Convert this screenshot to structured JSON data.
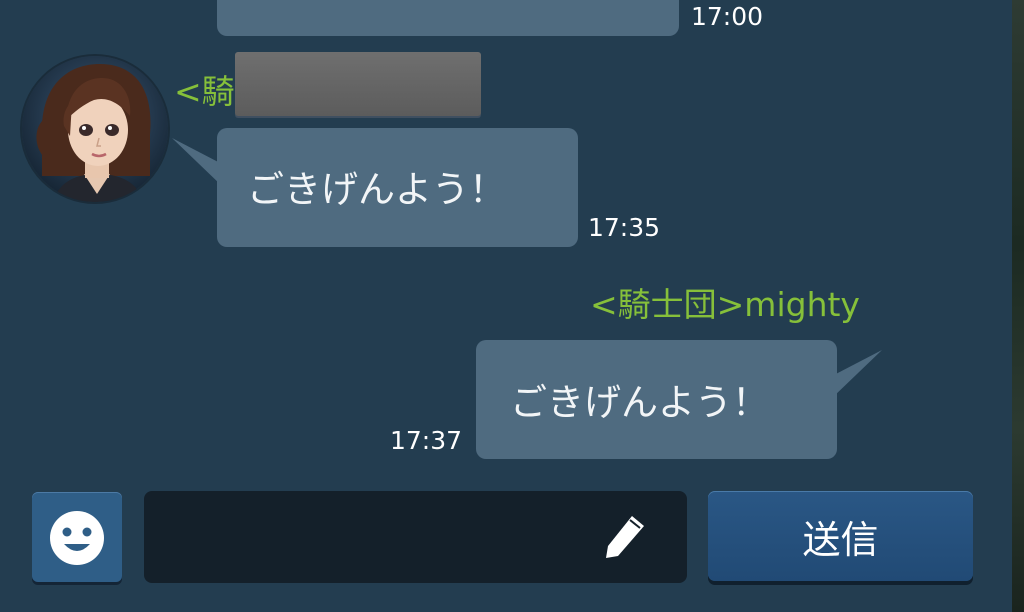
{
  "colors": {
    "background": "#233d50",
    "bubble": "#4f6b80",
    "sender_name": "#86c03a",
    "input_bg": "#14202a",
    "send_button": "#2a5785"
  },
  "messages": [
    {
      "direction": "incoming",
      "text": "",
      "time": "17:00"
    },
    {
      "direction": "incoming",
      "sender_prefix": "<騎",
      "sender_redacted": true,
      "avatar": "female-character-avatar",
      "text": "ごきげんよう！",
      "time": "17:35"
    },
    {
      "direction": "outgoing",
      "sender": "<騎士団>mighty",
      "text": "ごきげんよう！",
      "time": "17:37"
    }
  ],
  "input_bar": {
    "emoji_icon": "smiley-face-icon",
    "text_value": "",
    "edit_icon": "pencil-icon",
    "send_label": "送信"
  }
}
